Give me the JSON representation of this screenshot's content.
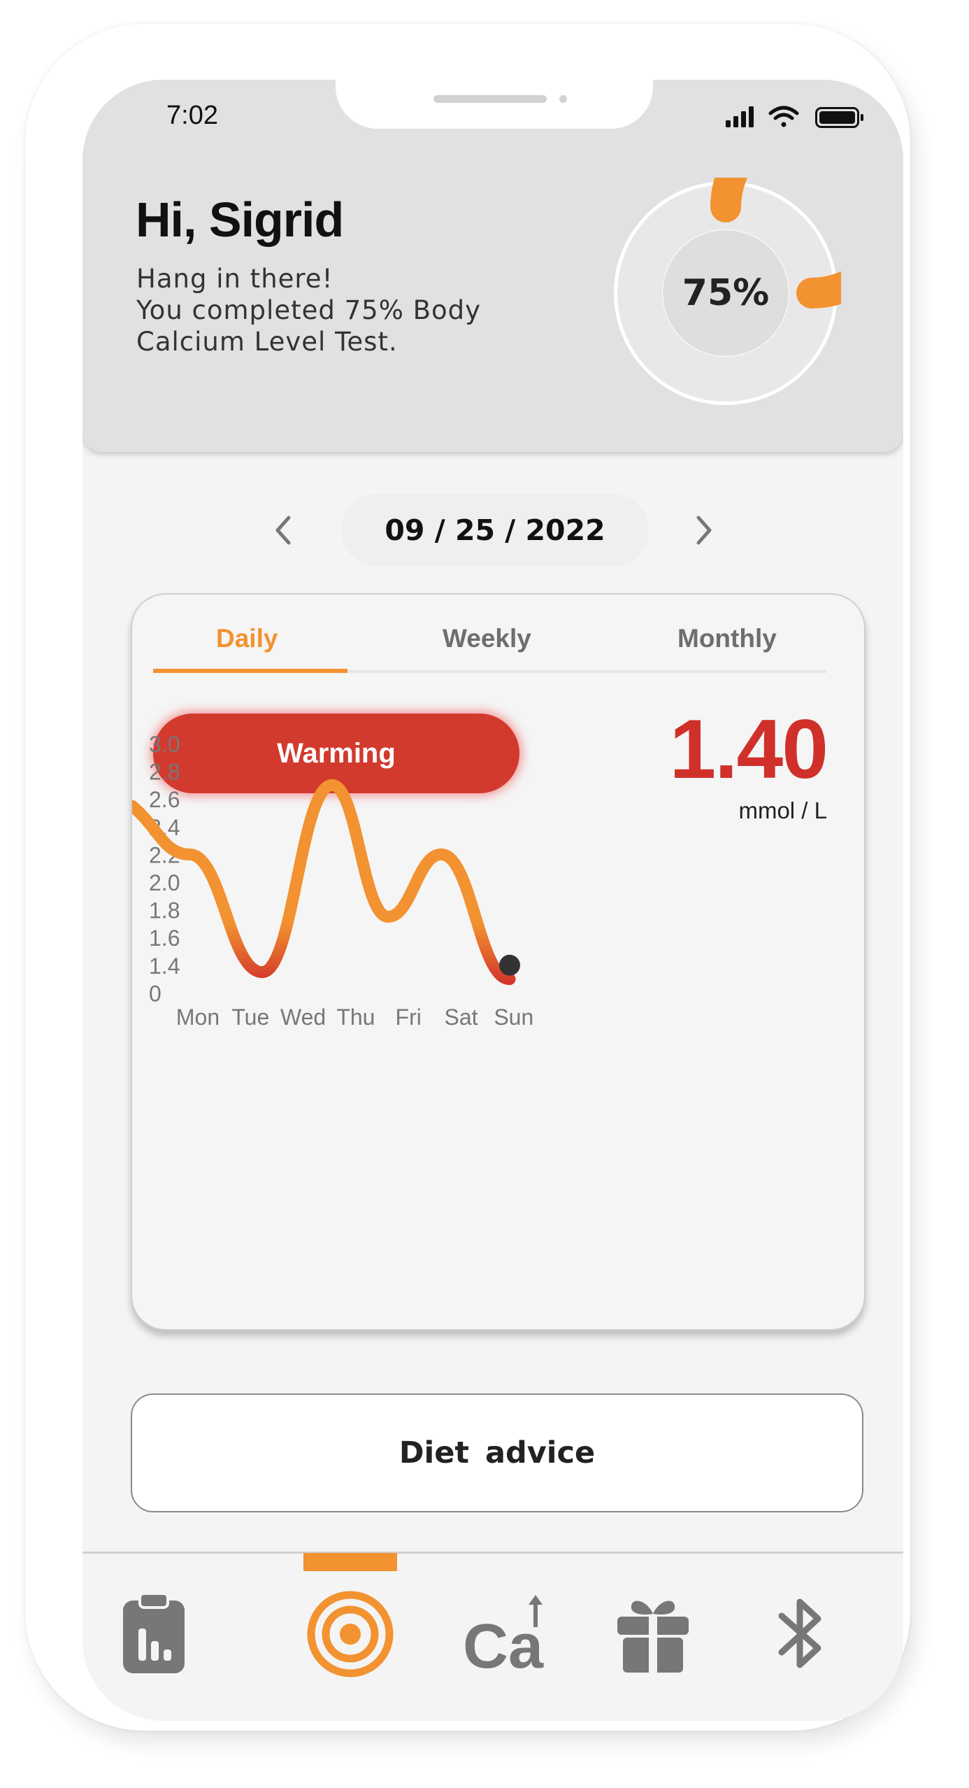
{
  "status_bar": {
    "time": "7:02",
    "icons": [
      "signal-icon",
      "wifi-icon",
      "battery-icon"
    ]
  },
  "header": {
    "greeting": "Hi, Sigrid",
    "message_lines": [
      "Hang in there!",
      "You completed 75% Body",
      "Calcium Level Test."
    ],
    "progress_label": "75%",
    "progress_fraction": 0.75
  },
  "date_nav": {
    "date": "09 / 25 / 2022",
    "prev_icon": "chevron-left-icon",
    "next_icon": "chevron-right-icon"
  },
  "card": {
    "tabs": [
      {
        "label": "Daily",
        "active": true
      },
      {
        "label": "Weekly",
        "active": false
      },
      {
        "label": "Monthly",
        "active": false
      }
    ],
    "status_badge": "Warming",
    "reading_value": "1.40",
    "reading_unit": "mmol / L"
  },
  "chart_data": {
    "type": "line",
    "categories": [
      "Mon",
      "Tue",
      "Wed",
      "Thu",
      "Fri",
      "Sat",
      "Sun"
    ],
    "y_tick_labels": [
      "3.0",
      "2.8",
      "2.6",
      "2.4",
      "2.2",
      "2.0",
      "1.8",
      "1.6",
      "1.4",
      "0"
    ],
    "series": [
      {
        "values": [
          2.2,
          1.35,
          2.7,
          1.75,
          2.2,
          1.3
        ]
      }
    ],
    "start_value": 2.55,
    "last_value": 1.4,
    "grid": false,
    "legend": "none",
    "colors": {
      "high": "#f29230",
      "low": "#d0302a",
      "marker": "#333333"
    }
  },
  "actions": {
    "diet_advice": "Diet advice"
  },
  "nav": {
    "items": [
      {
        "icon": "clipboard-chart-icon",
        "active": false
      },
      {
        "icon": "target-icon",
        "active": true
      },
      {
        "icon": "calcium-icon",
        "text": "Ca",
        "active": false
      },
      {
        "icon": "gift-icon",
        "active": false
      },
      {
        "icon": "bluetooth-icon",
        "active": false
      }
    ]
  },
  "colors": {
    "accent": "#f29230",
    "alert": "#d0302a",
    "header_bg": "#e1e1e1",
    "screen_bg": "#f4f4f4"
  }
}
